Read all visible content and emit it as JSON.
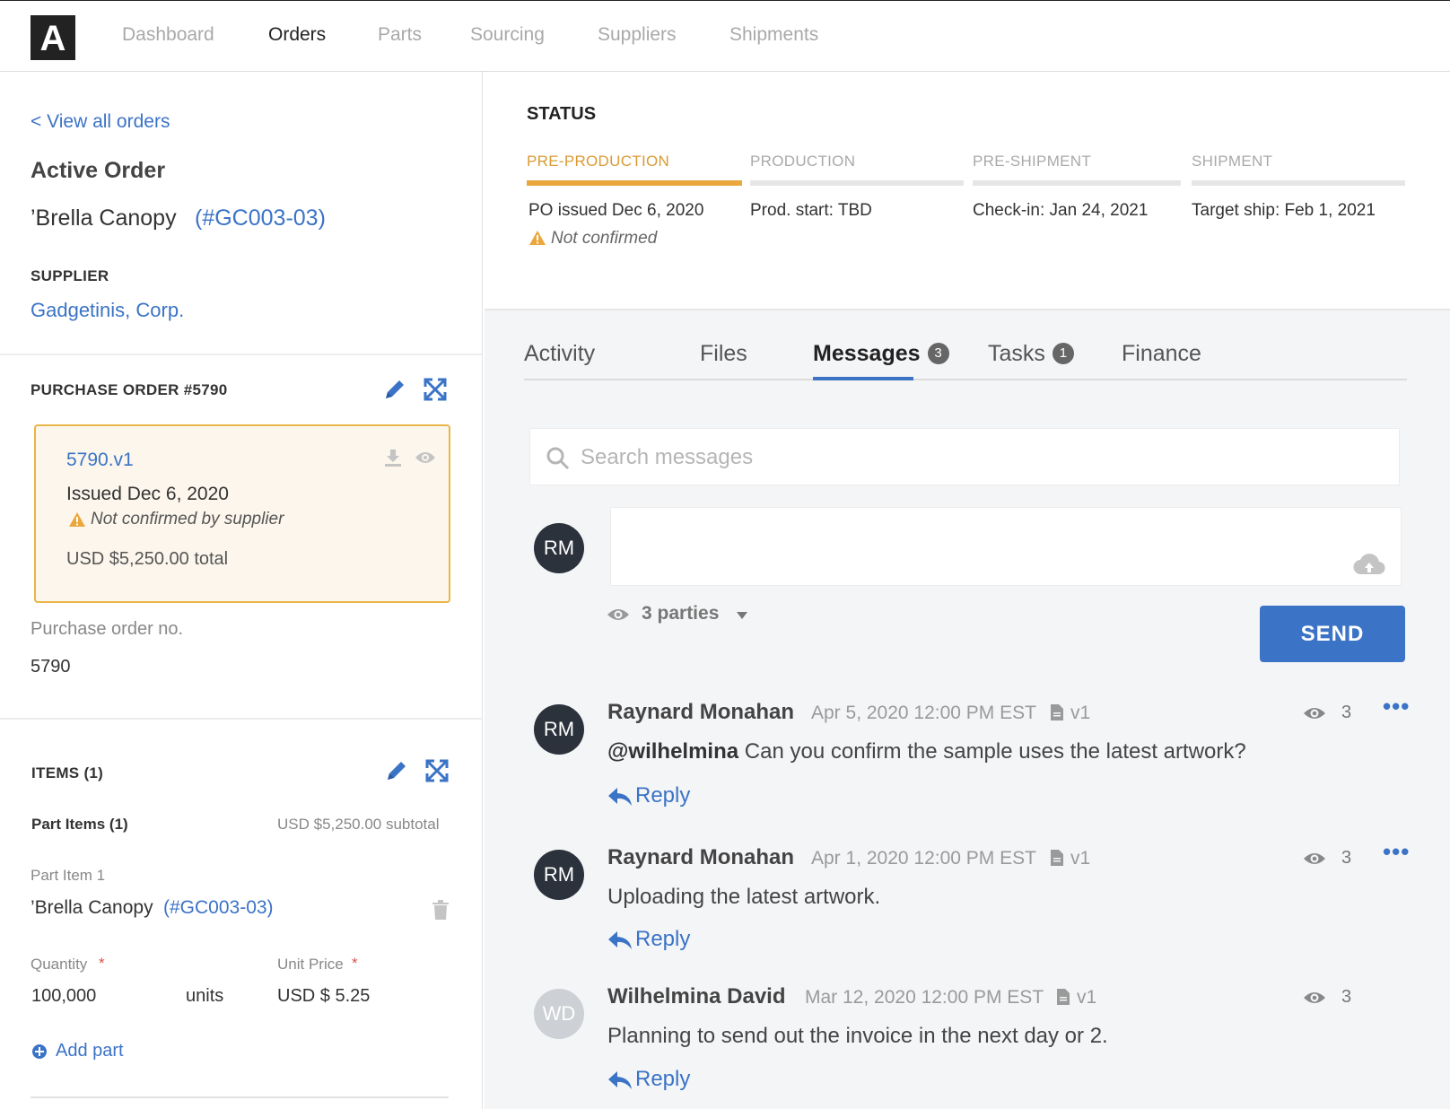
{
  "nav": {
    "logo": "A",
    "items": [
      "Dashboard",
      "Orders",
      "Parts",
      "Sourcing",
      "Suppliers",
      "Shipments"
    ],
    "active": "Orders"
  },
  "left": {
    "back_link": "< View all orders",
    "active_order_label": "Active Order",
    "order_name": "’Brella Canopy",
    "order_code": "(#GC003-03)",
    "supplier_label": "SUPPLIER",
    "supplier_name": "Gadgetinis, Corp.",
    "po": {
      "title": "PURCHASE ORDER #5790",
      "version": "5790.v1",
      "issued": "Issued Dec 6, 2020",
      "warning": "Not confirmed by supplier",
      "total": "USD $5,250.00 total",
      "number_label": "Purchase order no.",
      "number_value": "5790"
    },
    "items": {
      "title": "ITEMS (1)",
      "part_items_label": "Part Items (1)",
      "subtotal": "USD $5,250.00 subtotal",
      "part_item_label": "Part Item 1",
      "part_name": "’Brella Canopy",
      "part_code": "(#GC003-03)",
      "quantity_label": "Quantity",
      "quantity_value": "100,000",
      "quantity_unit": "units",
      "unit_price_label": "Unit Price",
      "unit_price_value": "USD $ 5.25",
      "required_mark": "*",
      "add_part": "Add part"
    }
  },
  "status": {
    "title": "STATUS",
    "stages": [
      {
        "label": "PRE-PRODUCTION",
        "value": "PO issued Dec 6, 2020",
        "note": "Not confirmed",
        "active": true
      },
      {
        "label": "PRODUCTION",
        "value": "Prod. start: TBD"
      },
      {
        "label": "PRE-SHIPMENT",
        "value": "Check-in: Jan 24, 2021"
      },
      {
        "label": "SHIPMENT",
        "value": "Target ship: Feb 1, 2021"
      }
    ]
  },
  "tabs": [
    {
      "label": "Activity"
    },
    {
      "label": "Files"
    },
    {
      "label": "Messages",
      "badge": "3",
      "active": true
    },
    {
      "label": "Tasks",
      "badge": "1"
    },
    {
      "label": "Finance"
    }
  ],
  "search": {
    "placeholder": "Search messages"
  },
  "composer": {
    "avatar": "RM",
    "parties": "3 parties",
    "send_label": "SEND"
  },
  "messages": [
    {
      "avatar": "RM",
      "author": "Raynard Monahan",
      "date": "Apr 5, 2020 12:00 PM EST",
      "version": "v1",
      "mention": "@wilhelmina",
      "text": "Can you confirm the sample uses the latest artwork?",
      "views": "3",
      "reply": "Reply"
    },
    {
      "avatar": "RM",
      "author": "Raynard Monahan",
      "date": "Apr 1, 2020 12:00 PM EST",
      "version": "v1",
      "mention": "",
      "text": "Uploading the latest artwork.",
      "views": "3",
      "reply": "Reply"
    },
    {
      "avatar": "WD",
      "author": "Wilhelmina David",
      "date": "Mar 12, 2020 12:00 PM EST",
      "version": "v1",
      "mention": "",
      "text": "Planning to send out the invoice in the next day or 2.",
      "views": "3",
      "reply": "Reply"
    }
  ],
  "colors": {
    "accent": "#3b73c6",
    "warning": "#e9a73c",
    "avatar_dark": "#2b323b"
  }
}
